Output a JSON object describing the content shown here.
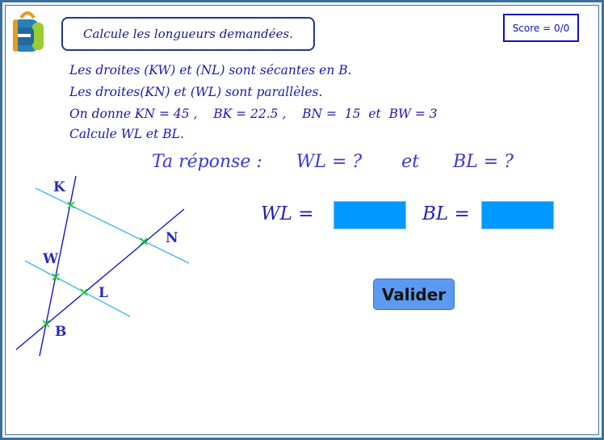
{
  "instruction": "Calcule les longueurs demandées.",
  "score": "Score = 0/0",
  "statement": [
    "Les droites (KW) et (NL) sont sécantes en B.",
    "Les droites(KN) et (WL) sont parallèles.",
    "On donne KN = 45 ,    BK = 22.5 ,    BN =  15  et  BW = 3",
    "Calcule WL et BL."
  ],
  "prompt": "Ta réponse :      WL = ?       et      BL = ?",
  "answers": {
    "wl_label": "WL =",
    "bl_label": "BL =",
    "wl_value": "",
    "bl_value": ""
  },
  "button": {
    "valider": "Valider"
  },
  "figure": {
    "points": {
      "K": "K",
      "N": "N",
      "W": "W",
      "L": "L",
      "B": "B"
    }
  },
  "colors": {
    "frame": "#3a6f9c",
    "text": "#1a1aa8",
    "answer_box": "#0099ff",
    "button": "#5b9af0",
    "parallel_lines": "#3bb6ee",
    "secant_lines": "#1414d0",
    "marks": "#22cc22"
  }
}
